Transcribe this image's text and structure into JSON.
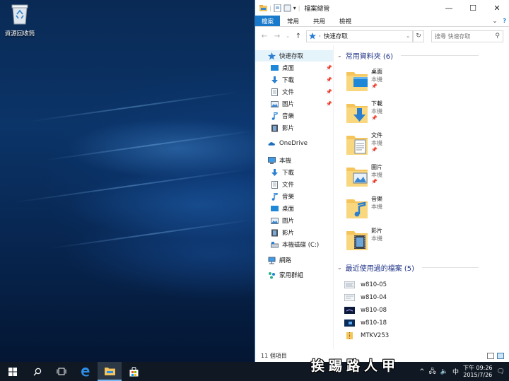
{
  "desktop": {
    "recycle_bin_label": "資源回收筒"
  },
  "window": {
    "title": "檔案總管",
    "controls": {
      "minimize": "—",
      "maximize": "☐",
      "close": "✕"
    }
  },
  "ribbon": {
    "tabs": [
      "檔案",
      "常用",
      "共用",
      "檢視"
    ],
    "accent": "#1979ca"
  },
  "address": {
    "path": "快速存取",
    "search_placeholder": "搜尋 快速存取"
  },
  "nav": {
    "quick_access": "快速存取",
    "quick_items": [
      "桌面",
      "下載",
      "文件",
      "圖片",
      "音樂",
      "影片"
    ],
    "onedrive": "OneDrive",
    "this_pc": "本機",
    "pc_items": [
      "下載",
      "文件",
      "音樂",
      "桌面",
      "圖片",
      "影片",
      "本機磁碟 (C:)"
    ],
    "network": "網路",
    "homegroup": "家用群組"
  },
  "content": {
    "frequent_header": "常用資料夾 (6)",
    "folders": [
      {
        "name": "桌面",
        "location": "本機"
      },
      {
        "name": "下載",
        "location": "本機"
      },
      {
        "name": "文件",
        "location": "本機"
      },
      {
        "name": "圖片",
        "location": "本機"
      },
      {
        "name": "音樂",
        "location": "本機"
      },
      {
        "name": "影片",
        "location": "本機"
      }
    ],
    "recent_header": "最近使用過的檔案 (5)",
    "recent": [
      "w810-05",
      "w810-04",
      "w810-08",
      "w810-18",
      "MTKV253"
    ]
  },
  "status": {
    "items": "11 個項目"
  },
  "taskbar": {
    "clock_time": "下午 09:26",
    "clock_date": "2015/7/26",
    "ime": "中",
    "tray_symbols": {
      "chevron": "^",
      "network": "🖧",
      "volume": "🔈",
      "message": "🗨"
    }
  },
  "watermark": "挨踢路人甲"
}
